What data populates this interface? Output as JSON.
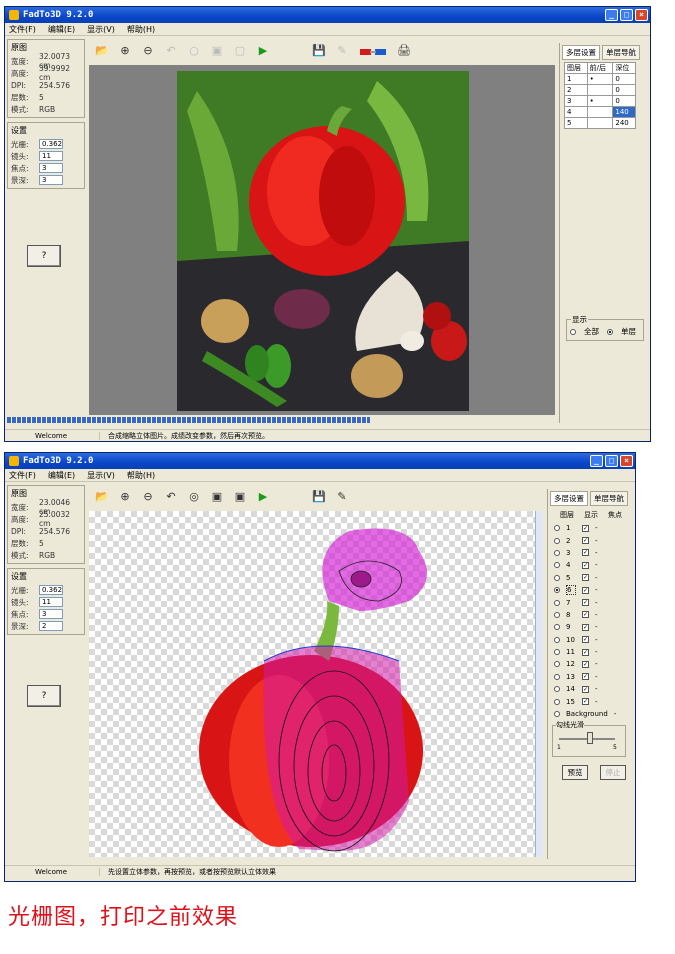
{
  "window1": {
    "title": "FadTo3D  9.2.0",
    "menu": [
      "文件(F)",
      "编辑(E)",
      "显示(V)",
      "帮助(H)"
    ],
    "original_group": {
      "title": "原图",
      "rows": [
        {
          "k": "宽度:",
          "v": "32.0073 cm"
        },
        {
          "k": "高度:",
          "v": "39.9992 cm"
        },
        {
          "k": "DPI:",
          "v": "254.576"
        },
        {
          "k": "层数:",
          "v": "5"
        },
        {
          "k": "模式:",
          "v": "RGB"
        }
      ]
    },
    "settings_group": {
      "title": "设置",
      "rows": [
        {
          "k": "光栅:",
          "v": "0.3621"
        },
        {
          "k": "镜头:",
          "v": "11"
        },
        {
          "k": "焦点:",
          "v": "3"
        },
        {
          "k": "景深:",
          "v": "3"
        }
      ]
    },
    "help_button": "?",
    "tabs": [
      "多层设置",
      "单层导航"
    ],
    "layer_table": {
      "headers": [
        "图层",
        "前/后",
        "深位"
      ],
      "rows": [
        [
          "1",
          "",
          "0"
        ],
        [
          "2",
          "",
          "0"
        ],
        [
          "3",
          "",
          "0"
        ],
        [
          "4",
          "",
          "140"
        ],
        [
          "5",
          "",
          "240"
        ]
      ]
    },
    "display_group": {
      "title": "显示",
      "options": [
        "全部",
        "单层"
      ],
      "selected": "单层"
    },
    "status": {
      "left": "Welcome",
      "right": "合成缩略立体图片。成绩改变参数，然后再次预览。"
    }
  },
  "window2": {
    "title": "FadTo3D  9.2.0",
    "menu": [
      "文件(F)",
      "编辑(E)",
      "显示(V)",
      "帮助(H)"
    ],
    "original_group": {
      "title": "原图",
      "rows": [
        {
          "k": "宽度:",
          "v": "23.0046 cm"
        },
        {
          "k": "高度:",
          "v": "25.0032 cm"
        },
        {
          "k": "DPI:",
          "v": "254.576"
        },
        {
          "k": "层数:",
          "v": "5"
        },
        {
          "k": "模式:",
          "v": "RGB"
        }
      ]
    },
    "settings_group": {
      "title": "设置",
      "rows": [
        {
          "k": "光栅:",
          "v": "0.3621"
        },
        {
          "k": "镜头:",
          "v": "11"
        },
        {
          "k": "焦点:",
          "v": "3"
        },
        {
          "k": "景深:",
          "v": "2"
        }
      ]
    },
    "help_button": "?",
    "tabs": [
      "多层设置",
      "单层导航"
    ],
    "layer_list_headers": [
      "图层",
      "显示",
      "焦点"
    ],
    "layers": [
      "1",
      "2",
      "3",
      "4",
      "5",
      "6",
      "7",
      "8",
      "9",
      "10",
      "11",
      "12",
      "13",
      "14",
      "15",
      "Background"
    ],
    "selected_layer": "6",
    "opacity_label": "勾线光滑",
    "slider_min": "1",
    "slider_max": "5",
    "preview_button": "预览",
    "stop_button": "停止",
    "status": {
      "left": "Welcome",
      "right": "先设置立体参数，再按预览，或者按预览默认立体效果"
    }
  },
  "caption": "光栅图，打印之前效果"
}
